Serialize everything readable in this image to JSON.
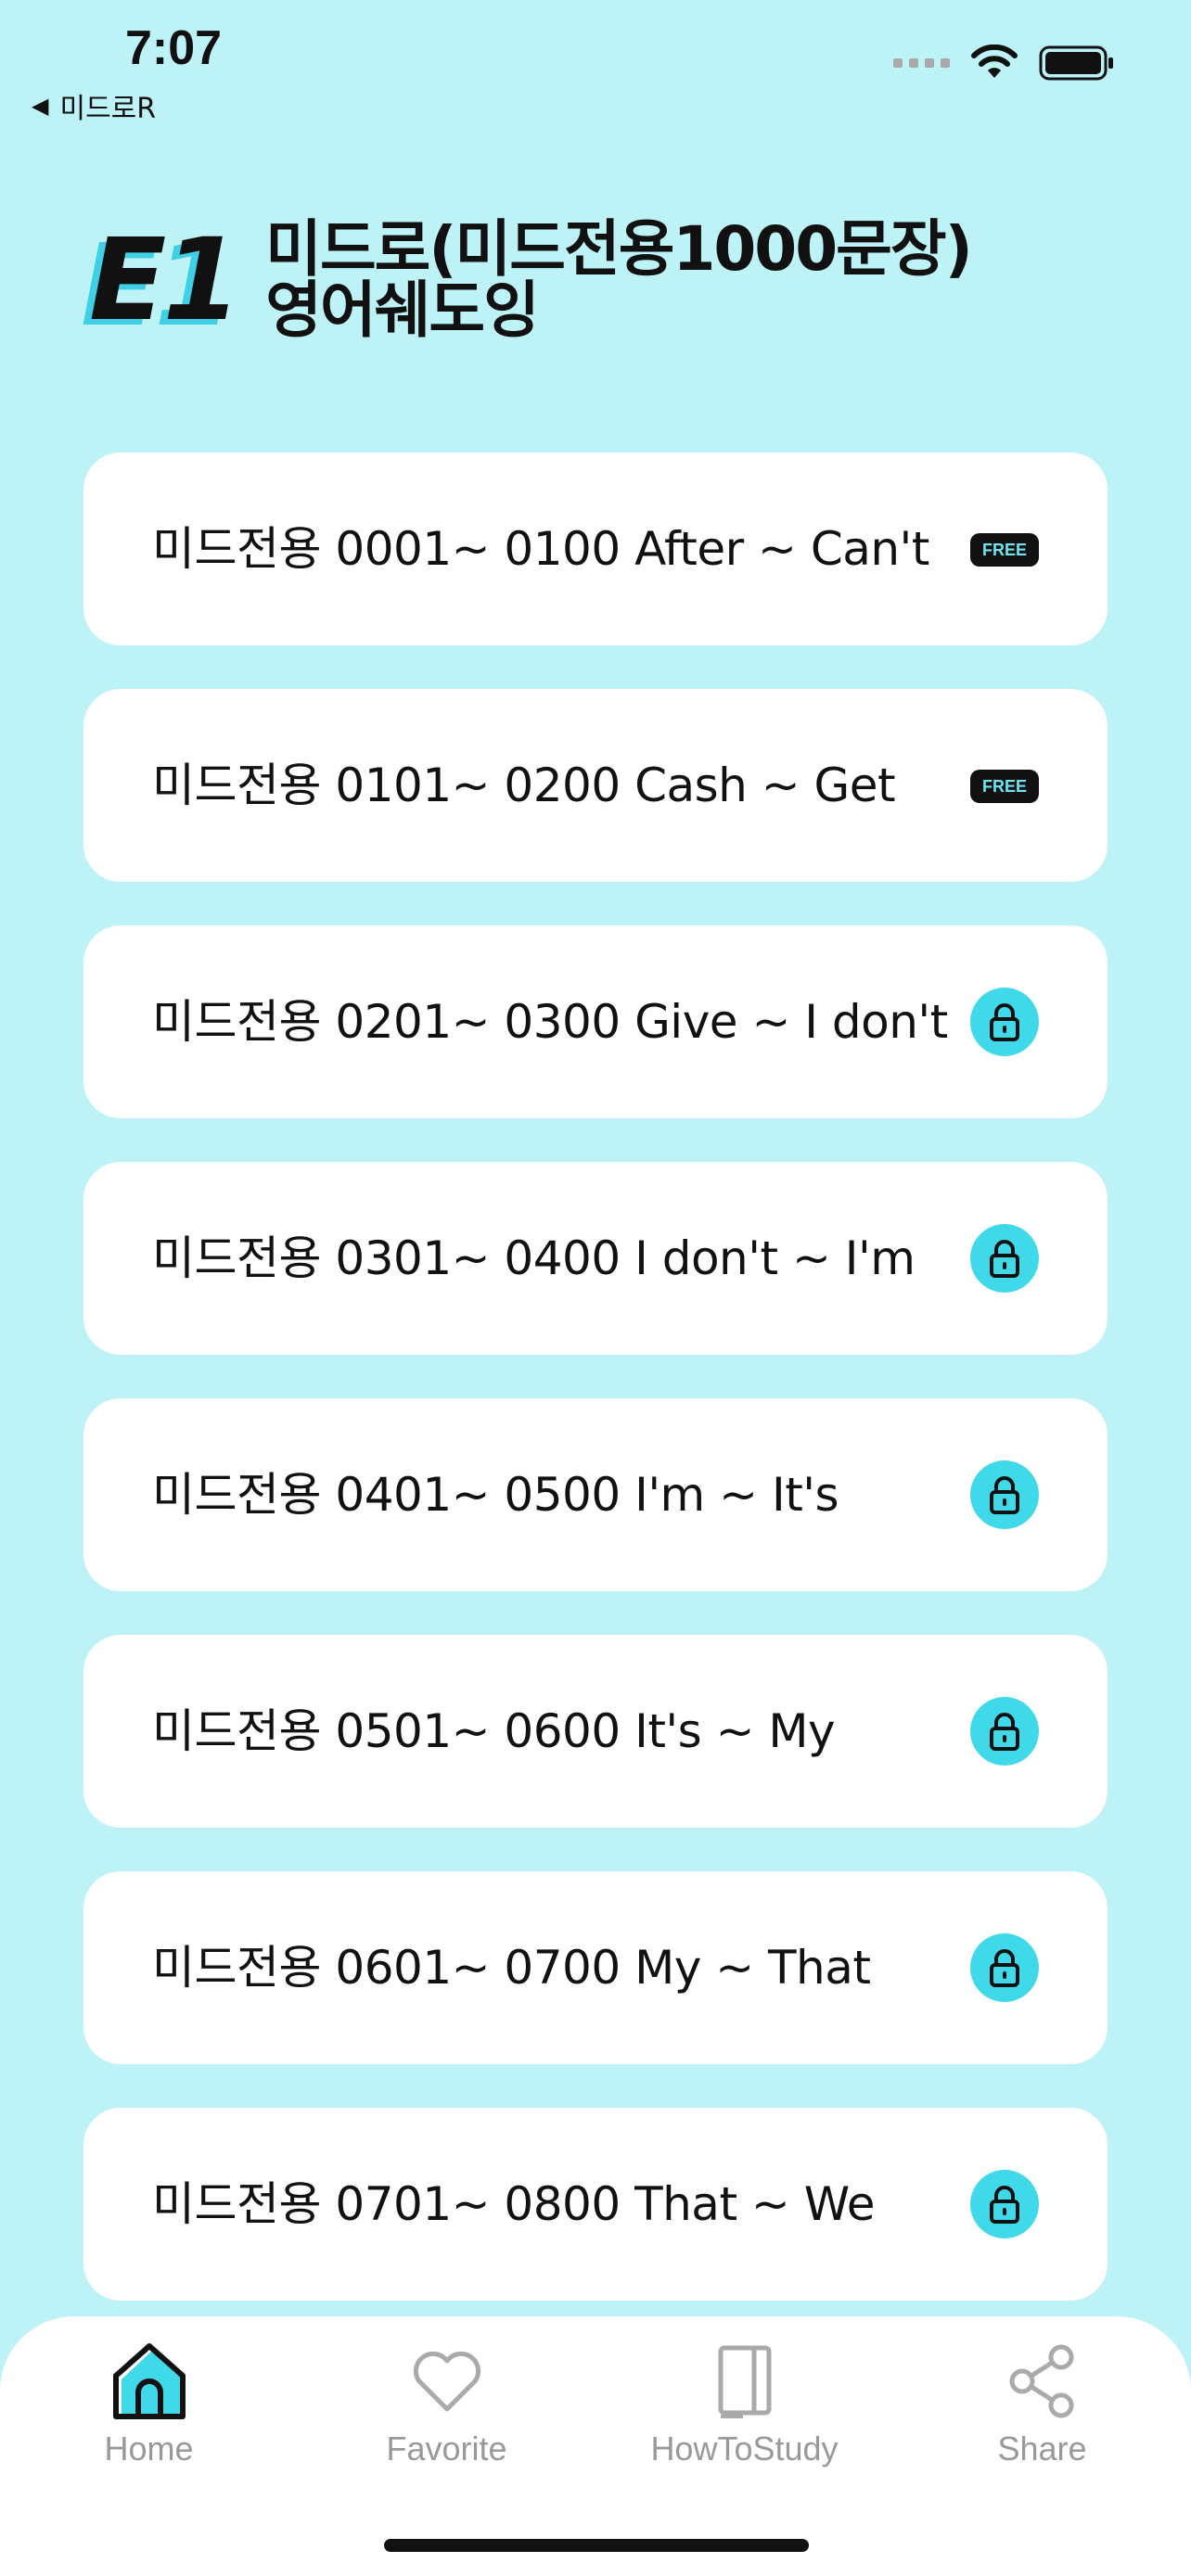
{
  "status_bar": {
    "time": "7:07",
    "back_label": "미드로R",
    "back_icon": "back-triangle-icon",
    "icons": [
      "signal-dots-icon",
      "wifi-icon",
      "battery-icon"
    ]
  },
  "header": {
    "tag": "E1",
    "title_line1": "미드로(미드전용1000문장)",
    "title_line2": "영어쉐도잉"
  },
  "chapters": [
    {
      "label": "미드전용 0001~ 0100 After ~ Can't",
      "badge": "free",
      "badge_text": "FREE"
    },
    {
      "label": "미드전용 0101~ 0200 Cash ~ Get",
      "badge": "free",
      "badge_text": "FREE"
    },
    {
      "label": "미드전용 0201~ 0300 Give ~ I don't",
      "badge": "lock"
    },
    {
      "label": "미드전용 0301~ 0400 I don't ~ I'm",
      "badge": "lock"
    },
    {
      "label": "미드전용 0401~ 0500 I'm ~ It's",
      "badge": "lock"
    },
    {
      "label": "미드전용 0501~ 0600 It's ~ My",
      "badge": "lock"
    },
    {
      "label": "미드전용 0601~ 0700 My ~ That",
      "badge": "lock"
    },
    {
      "label": "미드전용 0701~ 0800 That ~ We",
      "badge": "lock"
    }
  ],
  "tab_bar": {
    "tabs": [
      {
        "label": "Home",
        "icon": "home-icon",
        "active": true
      },
      {
        "label": "Favorite",
        "icon": "heart-icon",
        "active": false
      },
      {
        "label": "HowToStudy",
        "icon": "notebook-icon",
        "active": false
      },
      {
        "label": "Share",
        "icon": "share-icon",
        "active": false
      }
    ]
  },
  "colors": {
    "background": "#bdf2f6",
    "accent": "#3fd9ea",
    "card": "#ffffff",
    "text": "#111111",
    "tab_label": "#999999"
  }
}
